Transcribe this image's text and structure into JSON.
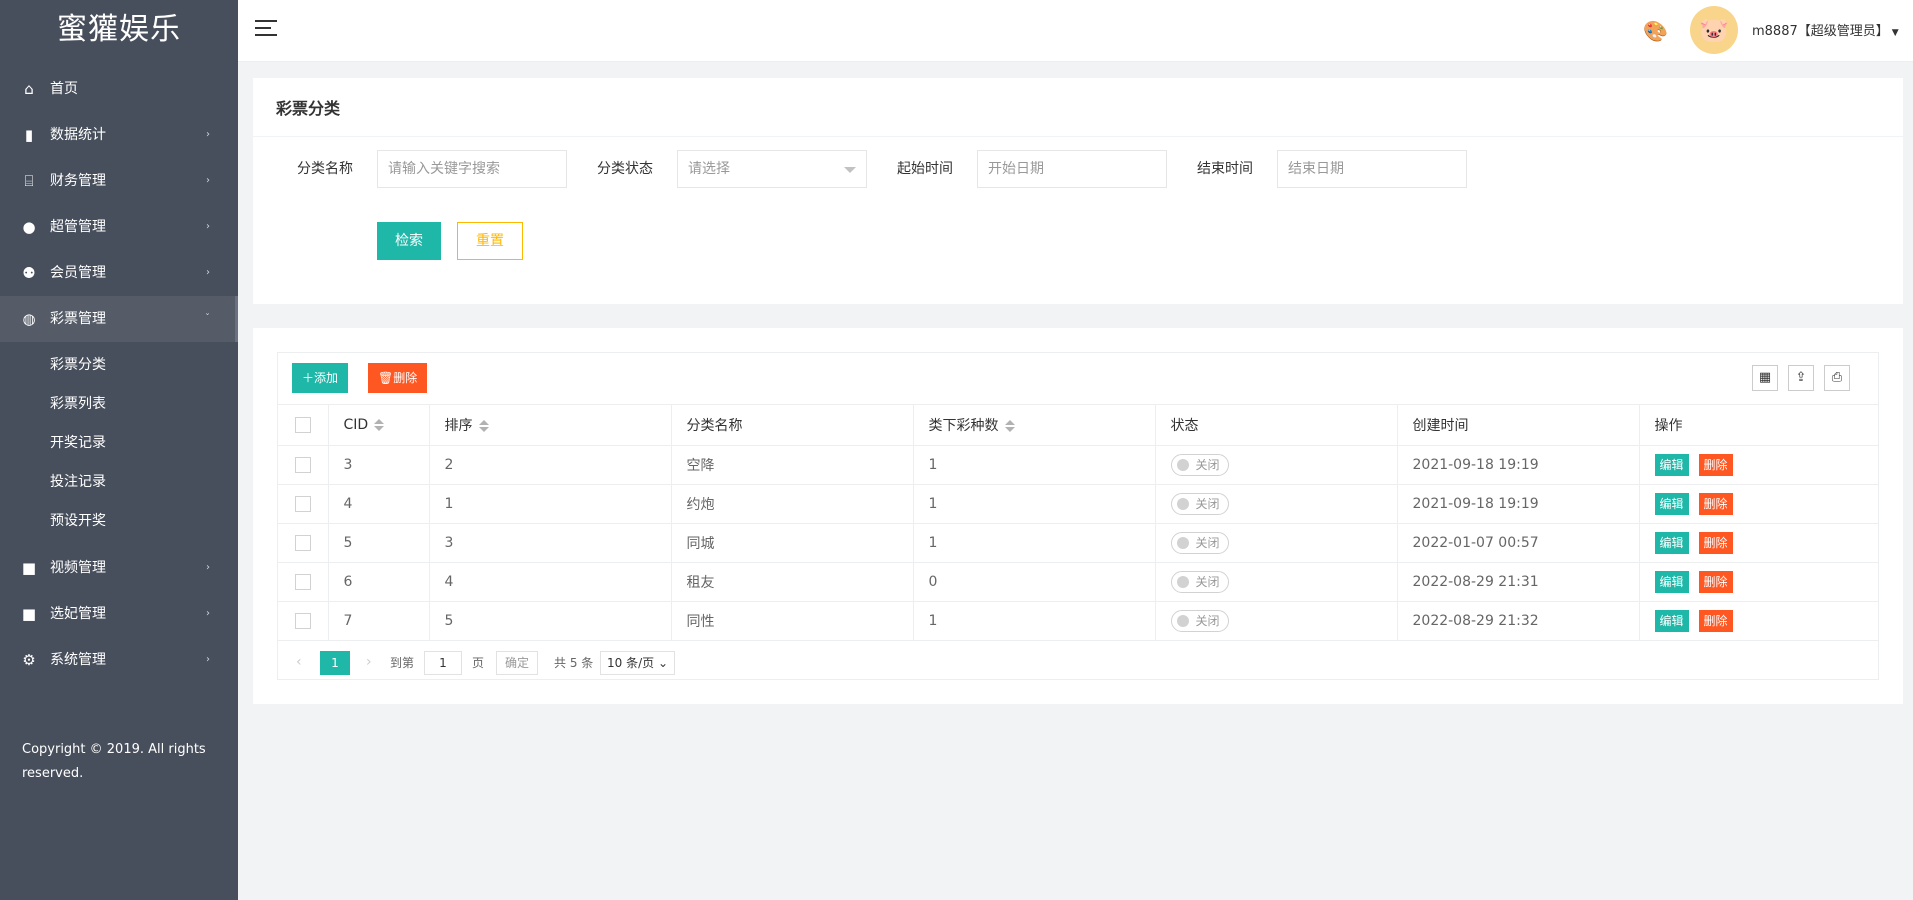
{
  "sidebar": {
    "logo": "蜜獾娱乐",
    "items": [
      {
        "label": "首页",
        "icon": "home-icon",
        "glyph": "⌂"
      },
      {
        "label": "数据统计",
        "icon": "bar-chart-icon",
        "glyph": "▮"
      },
      {
        "label": "财务管理",
        "icon": "bank-icon",
        "glyph": "⌸"
      },
      {
        "label": "超管管理",
        "icon": "user-icon",
        "glyph": "●"
      },
      {
        "label": "会员管理",
        "icon": "users-icon",
        "glyph": "⚉"
      },
      {
        "label": "彩票管理",
        "icon": "gamepad-icon",
        "glyph": "◍"
      }
    ],
    "sub_items": [
      "彩票分类",
      "彩票列表",
      "开奖记录",
      "投注记录",
      "预设开奖"
    ],
    "items_after": [
      {
        "label": "视频管理",
        "icon": "video-icon",
        "glyph": "■"
      },
      {
        "label": "选妃管理",
        "icon": "video-icon",
        "glyph": "■"
      },
      {
        "label": "系统管理",
        "icon": "gear-icon",
        "glyph": "⚙"
      }
    ],
    "copyright": "Copyright © 2019. All rights reserved."
  },
  "header": {
    "user": "m8887【超级管理员】"
  },
  "search_card": {
    "title": "彩票分类",
    "fields": [
      {
        "label": "分类名称",
        "placeholder": "请输入关键字搜索"
      },
      {
        "label": "分类状态",
        "placeholder": "请选择"
      },
      {
        "label": "起始时间",
        "placeholder": "开始日期"
      },
      {
        "label": "结束时间",
        "placeholder": "结束日期"
      }
    ],
    "search_button": "检索",
    "reset_button": "重置"
  },
  "table": {
    "add_button": "添加",
    "delete_button": "删除",
    "columns": [
      "CID",
      "排序",
      "分类名称",
      "类下彩种数",
      "状态",
      "创建时间",
      "操作"
    ],
    "rows": [
      {
        "cid": "3",
        "sort": "2",
        "name": "空降",
        "count": "1",
        "status": "关闭",
        "created": "2021-09-18 19:19"
      },
      {
        "cid": "4",
        "sort": "1",
        "name": "约炮",
        "count": "1",
        "status": "关闭",
        "created": "2021-09-18 19:19"
      },
      {
        "cid": "5",
        "sort": "3",
        "name": "同城",
        "count": "1",
        "status": "关闭",
        "created": "2022-01-07 00:57"
      },
      {
        "cid": "6",
        "sort": "4",
        "name": "租友",
        "count": "0",
        "status": "关闭",
        "created": "2022-08-29 21:31"
      },
      {
        "cid": "7",
        "sort": "5",
        "name": "同性",
        "count": "1",
        "status": "关闭",
        "created": "2022-08-29 21:32"
      }
    ],
    "edit_label": "编辑",
    "row_delete_label": "删除"
  },
  "pager": {
    "current": "1",
    "goto_label": "到第",
    "goto_value": "1",
    "page_unit": "页",
    "confirm": "确定",
    "total": "共 5 条",
    "page_size": "10 条/页"
  },
  "colors": {
    "sidebar_bg": "#484f5c",
    "primary": "#1eb7a8",
    "danger": "#ff5722",
    "warn": "#ffb800"
  }
}
